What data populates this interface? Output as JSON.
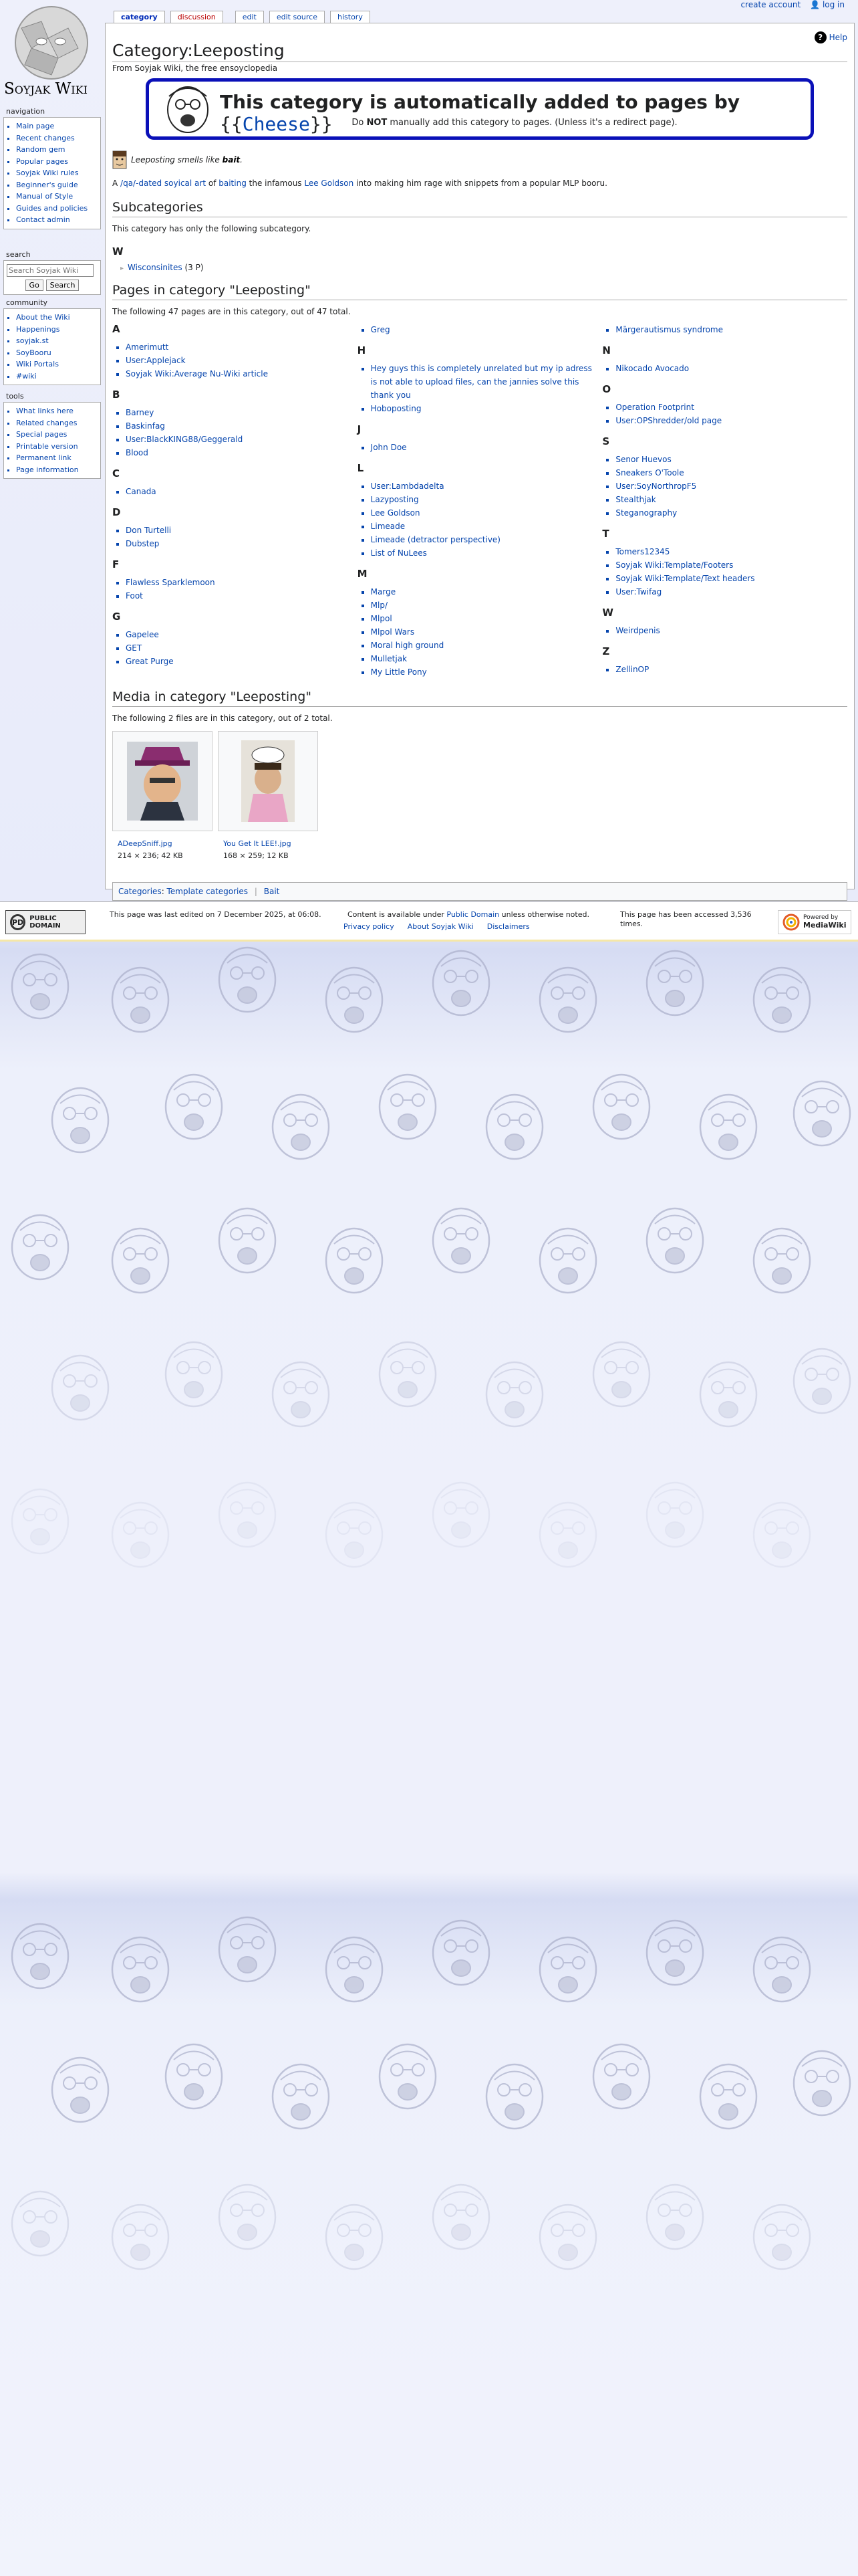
{
  "personal": {
    "create_account": "create account",
    "log_in": "log in"
  },
  "logo": {
    "text": "Soyjak Wiki"
  },
  "sidebar": {
    "navigation": {
      "heading": "navigation",
      "items": [
        "Main page",
        "Recent changes",
        "Random gem",
        "Popular pages",
        "Soyjak Wiki rules",
        "Beginner's guide",
        "Manual of Style",
        "Guides and policies",
        "Contact admin"
      ]
    },
    "search": {
      "heading": "search",
      "placeholder": "Search Soyjak Wiki",
      "go": "Go",
      "search": "Search"
    },
    "community": {
      "heading": "community",
      "items": [
        "About the Wiki",
        "Happenings",
        "soyjak.st",
        "SoyBooru",
        "Wiki Portals",
        "#wiki"
      ]
    },
    "tools": {
      "heading": "tools",
      "items": [
        "What links here",
        "Related changes",
        "Special pages",
        "Printable version",
        "Permanent link",
        "Page information"
      ]
    }
  },
  "tabs": [
    "category",
    "discussion",
    "edit",
    "edit source",
    "history"
  ],
  "help_label": "Help",
  "page": {
    "title": "Category:Leeposting",
    "tagline": "From Soyjak Wiki, the free ensoyclopedia",
    "notice": {
      "headline": "This category is automatically added to pages by",
      "template_open": "{{",
      "template_name": "Cheese",
      "template_close": "}}",
      "sub_pre": "Do ",
      "sub_bold": "NOT",
      "sub_post": " manually add this category to pages. (Unless it's a redirect page)."
    },
    "bait_pre": "Leeposting smells like ",
    "bait_word": "bait",
    "bait_post": ".",
    "desc": {
      "p1": "A ",
      "l1": "/qa/-dated",
      "p2": " ",
      "l2": "soyical art",
      "p3": " of ",
      "l3": "baiting",
      "p4": " the infamous ",
      "l4": "Lee Goldson",
      "p5": " into making him rage with snippets from a popular MLP booru."
    },
    "subcategories": {
      "heading": "Subcategories",
      "intro": "This category has only the following subcategory.",
      "letter": "W",
      "item": "Wisconsinites",
      "count": "(3 P)"
    },
    "pages": {
      "heading": "Pages in category \"Leeposting\"",
      "intro": "The following 47 pages are in this category, out of 47 total.",
      "columns": [
        [
          {
            "letter": "A",
            "items": [
              "Amerimutt",
              "User:Applejack",
              "Soyjak Wiki:Average Nu-Wiki article"
            ]
          },
          {
            "letter": "B",
            "items": [
              "Barney",
              "Baskinfag",
              "User:BlackKING88/Geggerald",
              "Blood"
            ]
          },
          {
            "letter": "C",
            "items": [
              "Canada"
            ]
          },
          {
            "letter": "D",
            "items": [
              "Don Turtelli",
              "Dubstep"
            ]
          },
          {
            "letter": "F",
            "items": [
              "Flawless Sparklemoon",
              "Foot"
            ]
          },
          {
            "letter": "G",
            "items": [
              "Gapelee",
              "GET",
              "Great Purge"
            ]
          }
        ],
        [
          {
            "letter": "",
            "items": [
              "Greg"
            ]
          },
          {
            "letter": "H",
            "items": [
              "Hey guys this is completely unrelated but my ip adress is not able to upload files, can the jannies solve this thank you",
              "Hoboposting"
            ]
          },
          {
            "letter": "J",
            "items": [
              "John Doe"
            ]
          },
          {
            "letter": "L",
            "items": [
              "User:Lambdadelta",
              "Lazyposting",
              "Lee Goldson",
              "Limeade",
              "Limeade (detractor perspective)",
              "List of NuLees"
            ]
          },
          {
            "letter": "M",
            "items": [
              "Marge",
              "Mlp/",
              "Mlpol",
              "Mlpol Wars",
              "Moral high ground",
              "Mulletjak",
              "My Little Pony"
            ]
          }
        ],
        [
          {
            "letter": "",
            "items": [
              "Märgerautismus syndrome"
            ]
          },
          {
            "letter": "N",
            "items": [
              "Nikocado Avocado"
            ]
          },
          {
            "letter": "O",
            "items": [
              "Operation Footprint",
              "User:OPShredder/old page"
            ]
          },
          {
            "letter": "S",
            "items": [
              "Senor Huevos",
              "Sneakers O'Toole",
              "User:SoyNorthropF5",
              "Stealthjak",
              "Steganography"
            ]
          },
          {
            "letter": "T",
            "items": [
              "Tomers12345",
              "Soyjak Wiki:Template/Footers",
              "Soyjak Wiki:Template/Text headers",
              "User:Twifag"
            ]
          },
          {
            "letter": "W",
            "items": [
              "Weirdpenis"
            ]
          },
          {
            "letter": "Z",
            "items": [
              "ZellinOP"
            ]
          }
        ]
      ]
    },
    "media": {
      "heading": "Media in category \"Leeposting\"",
      "intro": "The following 2 files are in this category, out of 2 total.",
      "files": [
        {
          "name": "ADeepSniff.jpg",
          "meta": "214 × 236; 42 KB"
        },
        {
          "name": "You Get It LEE!.jpg",
          "meta": "168 × 259; 12 KB"
        }
      ]
    },
    "catlinks": {
      "label": "Categories",
      "items": [
        "Template categories",
        "Bait"
      ]
    }
  },
  "footer": {
    "pd_badge": "PUBLIC DOMAIN",
    "pd_mark": "PD",
    "last_edited": "This page was last edited on 7 December 2025, at 06:08.",
    "content_pre": "Content is available under ",
    "content_link": "Public Domain",
    "content_post": " unless otherwise noted.",
    "accessed": "This page has been accessed 3,536 times.",
    "links": [
      "Privacy policy",
      "About Soyjak Wiki",
      "Disclaimers"
    ],
    "powered_by": "Powered by",
    "mediawiki": "MediaWiki"
  },
  "colors": {
    "link": "#0645ad",
    "notice_border": "#0a10b8",
    "red_link": "#ba0000"
  }
}
